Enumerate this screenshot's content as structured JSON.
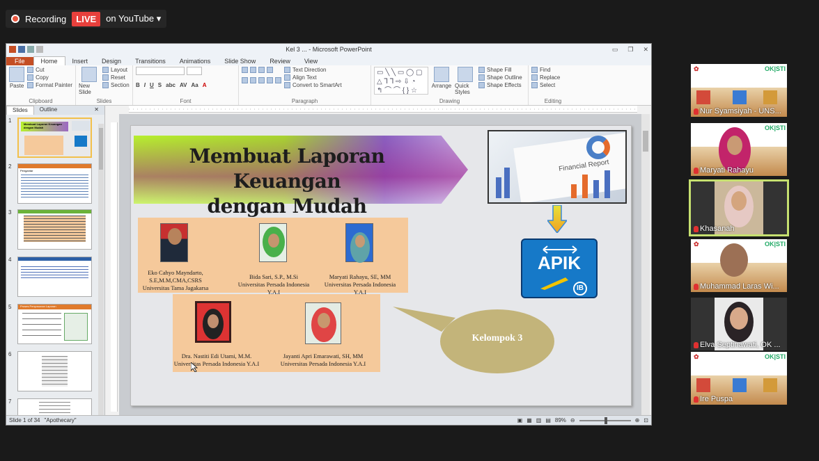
{
  "recording_bar": {
    "recording_label": "Recording",
    "live_label": "LIVE",
    "platform_label": "on YouTube"
  },
  "window": {
    "title": "Kel 3 ... - Microsoft PowerPoint"
  },
  "ribbon_tabs": [
    "File",
    "Home",
    "Insert",
    "Design",
    "Transitions",
    "Animations",
    "Slide Show",
    "Review",
    "View"
  ],
  "ribbon": {
    "clipboard": {
      "group": "Clipboard",
      "paste": "Paste",
      "cut": "Cut",
      "copy": "Copy",
      "format_painter": "Format Painter"
    },
    "slides": {
      "group": "Slides",
      "new_slide": "New Slide",
      "layout": "Layout",
      "reset": "Reset",
      "section": "Section"
    },
    "font": {
      "group": "Font",
      "bold": "B",
      "italic": "I",
      "underline": "U",
      "strike": "S",
      "abc": "abc",
      "av": "AV",
      "aa": "Aa",
      "a": "A"
    },
    "paragraph": {
      "group": "Paragraph",
      "text_direction": "Text Direction",
      "align_text": "Align Text",
      "convert": "Convert to SmartArt"
    },
    "drawing": {
      "group": "Drawing",
      "arrange": "Arrange",
      "quick_styles": "Quick Styles",
      "shape_fill": "Shape Fill",
      "shape_outline": "Shape Outline",
      "shape_effects": "Shape Effects"
    },
    "editing": {
      "group": "Editing",
      "find": "Find",
      "replace": "Replace",
      "select": "Select"
    }
  },
  "panel_tabs": {
    "slides": "Slides",
    "outline": "Outline"
  },
  "thumbnails": [
    {
      "num": "1",
      "title": "Membuat Laporan Keuangan dengan Mudah"
    },
    {
      "num": "2",
      "title": "Pengantar"
    },
    {
      "num": "3",
      "title": ""
    },
    {
      "num": "4",
      "title": ""
    },
    {
      "num": "5",
      "title": "Proses Penyusunan Laporan"
    },
    {
      "num": "6",
      "title": ""
    },
    {
      "num": "7",
      "title": ""
    }
  ],
  "slide": {
    "title_line1": "Membuat Laporan Keuangan",
    "title_line2": "dengan Mudah",
    "report_label": "Financial Report",
    "apik_logo": "APIK",
    "apik_badge": "IB",
    "members": [
      {
        "name": "Eko Cahyo Mayndarto, S.E,M.M,CMA,CSRS",
        "name_l1": "Eko Cahyo Mayndarto,",
        "name_l2": "S.E,M.M,CMA,CSRS",
        "affiliation": "Universitas Tama Jagakarsa"
      },
      {
        "name": "Bida Sari, S.P., M.Si",
        "affiliation": "Universitas Persada Indonesia Y.A.I"
      },
      {
        "name": "Maryati Rahayu, SE,  MM",
        "affiliation": "Universitas Persada Indonesia Y.A.I"
      },
      {
        "name": "Dra. Nastiti Edi Utami, M.M.",
        "affiliation": "Universitas Persada Indonesia Y.A.I"
      },
      {
        "name": "Jayanti Apri Emarawati,   SH, MM",
        "affiliation": "Universitas Persada Indonesia Y.A.I"
      }
    ],
    "group_label": "Kelompok 3"
  },
  "status_bar": {
    "slide_info": "Slide 1 of 34",
    "theme": "\"Apothecary\"",
    "zoom": "89%"
  },
  "participants": [
    {
      "name": "Nur Syamsiyah - UNS...",
      "video": false,
      "active": false
    },
    {
      "name": "Maryati Rahayu",
      "video": true,
      "active": false
    },
    {
      "name": "Khasanah",
      "video": true,
      "active": true
    },
    {
      "name": "Muhammad Laras Wi...",
      "video": true,
      "active": false
    },
    {
      "name": "Elva Septinawati, OK ...",
      "video": true,
      "active": false
    },
    {
      "name": "Ire Puspa",
      "video": false,
      "active": false
    }
  ],
  "colors": {
    "live_red": "#e8403c",
    "active_speaker": "#c6e070",
    "file_tab": "#c44e24"
  }
}
